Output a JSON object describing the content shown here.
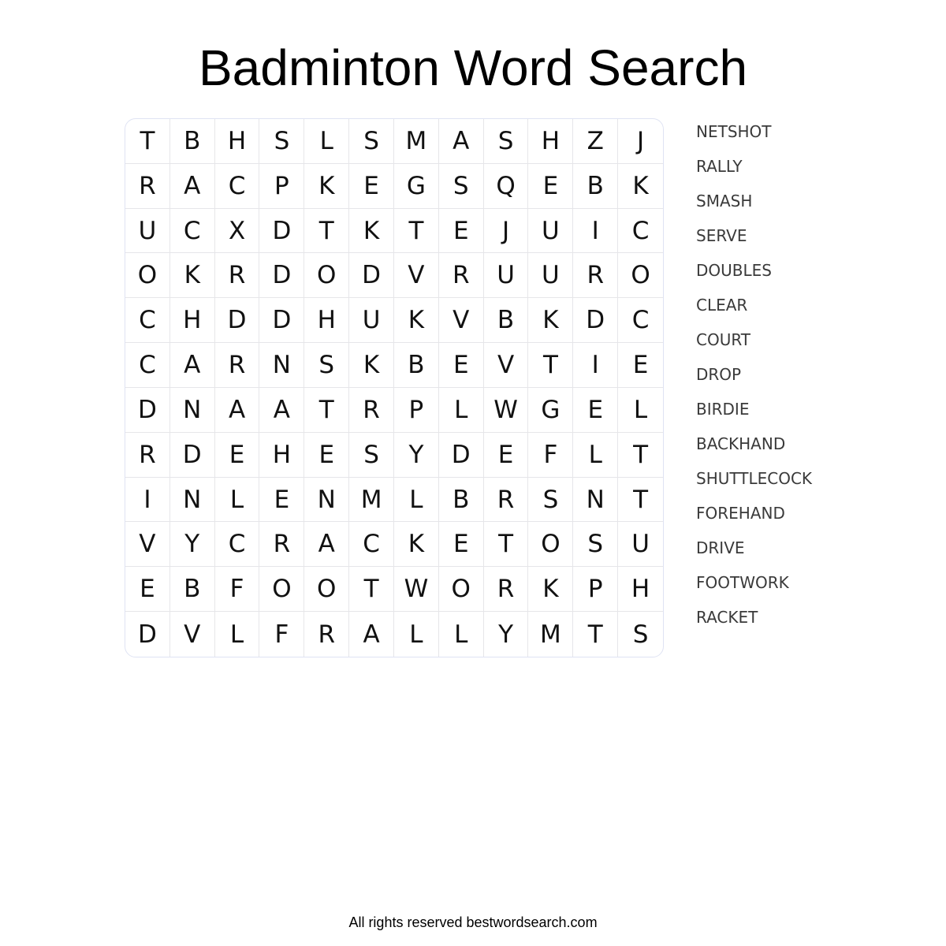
{
  "title": "Badminton Word Search",
  "grid": [
    [
      "T",
      "B",
      "H",
      "S",
      "L",
      "S",
      "M",
      "A",
      "S",
      "H",
      "Z",
      "J"
    ],
    [
      "R",
      "A",
      "C",
      "P",
      "K",
      "E",
      "G",
      "S",
      "Q",
      "E",
      "B",
      "K"
    ],
    [
      "U",
      "C",
      "X",
      "D",
      "T",
      "K",
      "T",
      "E",
      "J",
      "U",
      "I",
      "C"
    ],
    [
      "O",
      "K",
      "R",
      "D",
      "O",
      "D",
      "V",
      "R",
      "U",
      "U",
      "R",
      "O"
    ],
    [
      "C",
      "H",
      "D",
      "D",
      "H",
      "U",
      "K",
      "V",
      "B",
      "K",
      "D",
      "C"
    ],
    [
      "C",
      "A",
      "R",
      "N",
      "S",
      "K",
      "B",
      "E",
      "V",
      "T",
      "I",
      "E"
    ],
    [
      "D",
      "N",
      "A",
      "A",
      "T",
      "R",
      "P",
      "L",
      "W",
      "G",
      "E",
      "L"
    ],
    [
      "R",
      "D",
      "E",
      "H",
      "E",
      "S",
      "Y",
      "D",
      "E",
      "F",
      "L",
      "T"
    ],
    [
      "I",
      "N",
      "L",
      "E",
      "N",
      "M",
      "L",
      "B",
      "R",
      "S",
      "N",
      "T"
    ],
    [
      "V",
      "Y",
      "C",
      "R",
      "A",
      "C",
      "K",
      "E",
      "T",
      "O",
      "S",
      "U"
    ],
    [
      "E",
      "B",
      "F",
      "O",
      "O",
      "T",
      "W",
      "O",
      "R",
      "K",
      "P",
      "H"
    ],
    [
      "D",
      "V",
      "L",
      "F",
      "R",
      "A",
      "L",
      "L",
      "Y",
      "M",
      "T",
      "S"
    ]
  ],
  "words": [
    "NETSHOT",
    "RALLY",
    "SMASH",
    "SERVE",
    "DOUBLES",
    "CLEAR",
    "COURT",
    "DROP",
    "BIRDIE",
    "BACKHAND",
    "SHUTTLECOCK",
    "FOREHAND",
    "DRIVE",
    "FOOTWORK",
    "RACKET"
  ],
  "footer": "All rights reserved bestwordsearch.com"
}
